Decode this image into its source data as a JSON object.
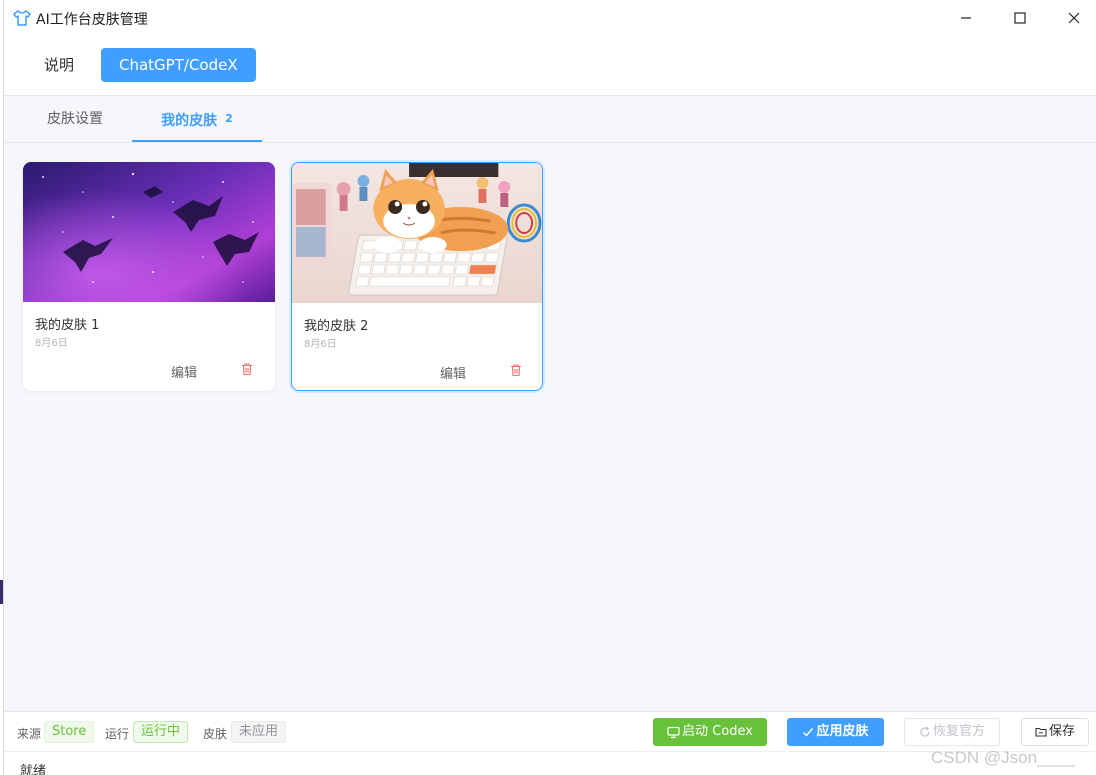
{
  "window": {
    "title": "AI工作台皮肤管理",
    "minimize_icon": "minimize-icon",
    "maximize_icon": "maximize-icon",
    "close_icon": "close-icon"
  },
  "top_tabs": [
    {
      "label": "说明",
      "active": false
    },
    {
      "label": "ChatGPT/CodeX",
      "active": true
    }
  ],
  "sub_tabs": [
    {
      "label": "皮肤设置",
      "active": false
    },
    {
      "label": "我的皮肤",
      "count": "2",
      "active": true
    }
  ],
  "skins": [
    {
      "name": "我的皮肤 1",
      "date": "8月6日",
      "edit_label": "编辑",
      "thumbnail": "purple-galaxy-silhouettes",
      "selected": false
    },
    {
      "name": "我的皮肤 2",
      "date": "8月6日",
      "edit_label": "编辑",
      "thumbnail": "cat-on-keyboard",
      "selected": true
    }
  ],
  "bottom_bar": {
    "source_label": "来源",
    "source_value": "Store",
    "run_label": "运行",
    "run_value": "运行中",
    "skin_label": "皮肤",
    "skin_value": "未应用",
    "launch_button": "启动 Codex",
    "apply_button": "应用皮肤",
    "restore_button": "恢复官方",
    "save_button": "保存"
  },
  "status": {
    "text": "就绪"
  },
  "watermark": "CSDN @Json____",
  "colors": {
    "primary": "#409eff",
    "success": "#67c23a",
    "danger": "#f56c6c"
  }
}
